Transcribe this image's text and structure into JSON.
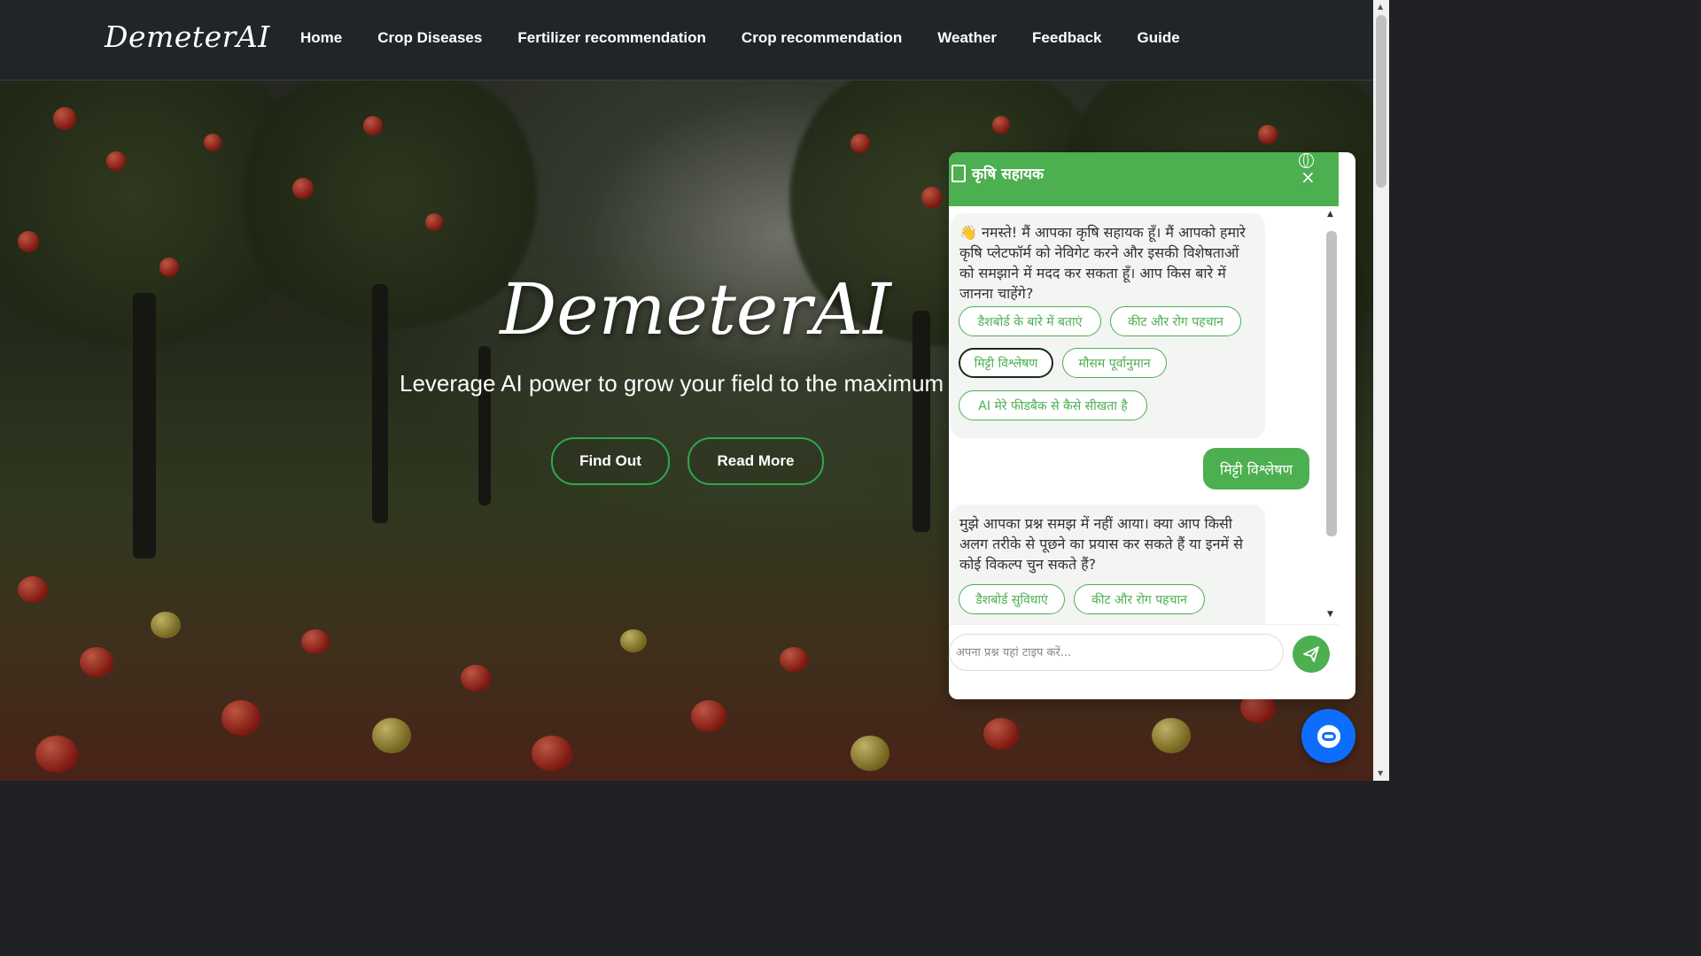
{
  "brand": "DemeterAI",
  "nav": {
    "items": [
      "Home",
      "Crop Diseases",
      "Fertilizer recommendation",
      "Crop recommendation",
      "Weather",
      "Feedback",
      "Guide"
    ]
  },
  "hero": {
    "title": "DemeterAI",
    "subtitle": "Leverage AI power to grow your field to the maximum",
    "buttons": [
      "Find Out",
      "Read More"
    ]
  },
  "chat": {
    "title": "कृषि सहायक",
    "close_label": "×",
    "messages": [
      {
        "from": "bot",
        "text": "👋 नमस्ते! मैं आपका कृषि सहायक हूँ। मैं आपको हमारे कृषि प्लेटफॉर्म को नेविगेट करने और इसकी विशेषताओं को समझाने में मदद कर सकता हूँ। आप किस बारे में जानना चाहेंगे?",
        "options": [
          "डैशबोर्ड के बारे में बताएं",
          "कीट और रोग पहचान",
          "मिट्टी विश्लेषण",
          "मौसम पूर्वानुमान",
          "AI मेरे फीडबैक से कैसे सीखता है"
        ],
        "selected": "मिट्टी विश्लेषण"
      },
      {
        "from": "user",
        "text": "मिट्टी विश्लेषण"
      },
      {
        "from": "bot",
        "text": "मुझे आपका प्रश्न समझ में नहीं आया। क्या आप किसी अलग तरीके से पूछने का प्रयास कर सकते हैं या इनमें से कोई विकल्प चुन सकते हैं?",
        "options": [
          "डैशबोर्ड सुविधाएं",
          "कीट और रोग पहचान"
        ]
      }
    ],
    "input_placeholder": "अपना प्रश्न यहां टाइप करें..."
  },
  "colors": {
    "navbar": "#212529",
    "accent_green": "#4caf50",
    "fab_blue": "#0d6efd"
  }
}
